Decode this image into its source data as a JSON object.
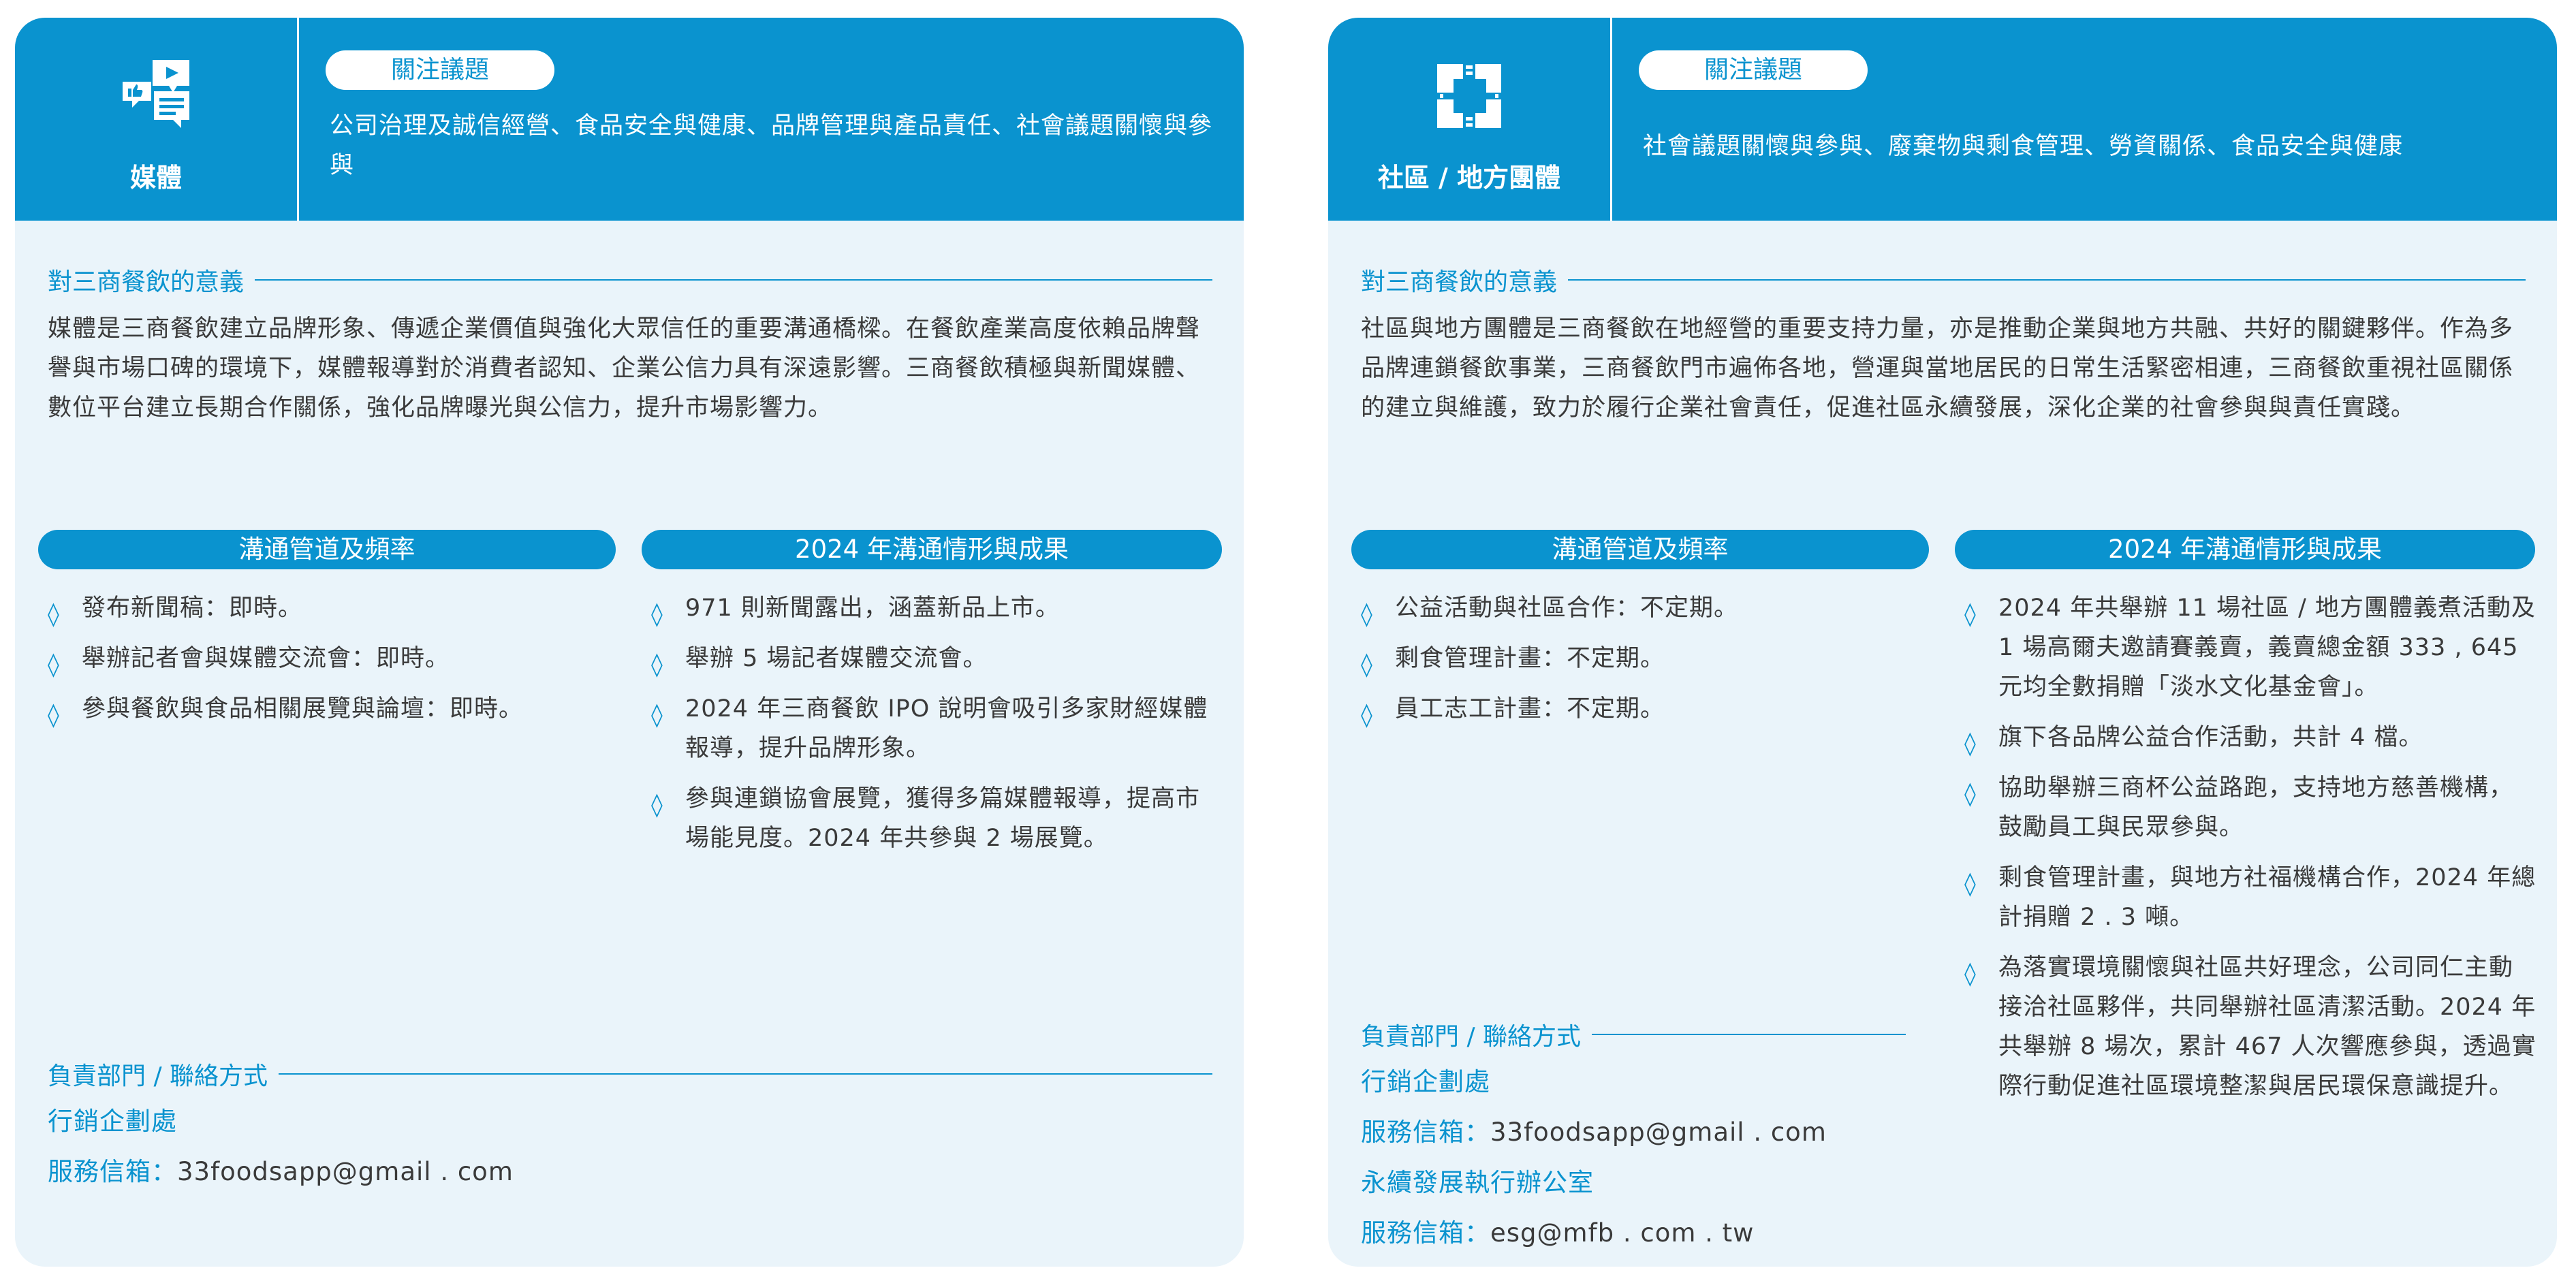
{
  "cards": [
    {
      "stakeholder": "媒體",
      "icon": "media-like-chat-icon",
      "focus_label": "關注議題",
      "focus_issues": "公司治理及誠信經營、食品安全與健康、品牌管理與產品責任、社會議題關懷與參與",
      "significance_heading": "對三商餐飲的意義",
      "significance": "媒體是三商餐飲建立品牌形象、傳遞企業價值與強化大眾信任的重要溝通橋樑。在餐飲產業高度依賴品牌聲譽與市場口碑的環境下，媒體報導對於消費者認知、企業公信力具有深遠影響。三商餐飲積極與新聞媒體、數位平台建立長期合作關係，強化品牌曝光與公信力，提升市場影響力。",
      "channels_heading": "溝通管道及頻率",
      "channels": [
        "發布新聞稿：即時。",
        "舉辦記者會與媒體交流會：即時。",
        "參與餐飲與食品相關展覽與論壇：即時。"
      ],
      "results_heading": "2024 年溝通情形與成果",
      "results": [
        "971 則新聞露出，涵蓋新品上市。",
        "舉辦 5 場記者媒體交流會。",
        "2024 年三商餐飲 IPO 說明會吸引多家財經媒體報導，提升品牌形象。",
        "參與連鎖協會展覽，獲得多篇媒體報導，提高市場能見度。2024 年共參與 2 場展覽。"
      ],
      "contact_heading": "負責部門 / 聯絡方式",
      "department_1": "行銷企劃處",
      "email_label_1": "服務信箱：",
      "email_1": "33foodsapp@gmail . com"
    },
    {
      "stakeholder": "社區 / 地方團體",
      "icon": "joined-hands-icon",
      "focus_label": "關注議題",
      "focus_issues": "社會議題關懷與參與、廢棄物與剩食管理、勞資關係、食品安全與健康",
      "significance_heading": "對三商餐飲的意義",
      "significance": "社區與地方團體是三商餐飲在地經營的重要支持力量，亦是推動企業與地方共融、共好的關鍵夥伴。作為多品牌連鎖餐飲事業，三商餐飲門市遍佈各地，營運與當地居民的日常生活緊密相連，三商餐飲重視社區關係的建立與維護，致力於履行企業社會責任，促進社區永續發展，深化企業的社會參與與責任實踐。",
      "channels_heading": "溝通管道及頻率",
      "channels": [
        "公益活動與社區合作：不定期。",
        "剩食管理計畫：不定期。",
        "員工志工計畫：不定期。"
      ],
      "results_heading": "2024 年溝通情形與成果",
      "results": [
        "2024 年共舉辦 11 場社區 / 地方團體義煮活動及 1 場高爾夫邀請賽義賣，義賣總金額 333 , 645 元均全數捐贈「淡水文化基金會」。",
        "旗下各品牌公益合作活動，共計 4 檔。",
        "協助舉辦三商杯公益路跑，支持地方慈善機構，鼓勵員工與民眾參與。",
        "剩食管理計畫，與地方社福機構合作，2024 年總計捐贈 2 . 3 噸。",
        "為落實環境關懷與社區共好理念，公司同仁主動接洽社區夥伴，共同舉辦社區清潔活動。2024 年共舉辦 8 場次，累計 467 人次響應參與，透過實際行動促進社區環境整潔與居民環保意識提升。"
      ],
      "contact_heading": "負責部門 / 聯絡方式",
      "department_1": "行銷企劃處",
      "email_label_1": "服務信箱：",
      "email_1": "33foodsapp@gmail . com",
      "department_2": "永續發展執行辦公室",
      "email_label_2": "服務信箱：",
      "email_2": "esg@mfb . com . tw"
    }
  ],
  "bullet_symbol": "◊",
  "accent_color": "#0a93cf",
  "card_background": "#eaf4fa"
}
